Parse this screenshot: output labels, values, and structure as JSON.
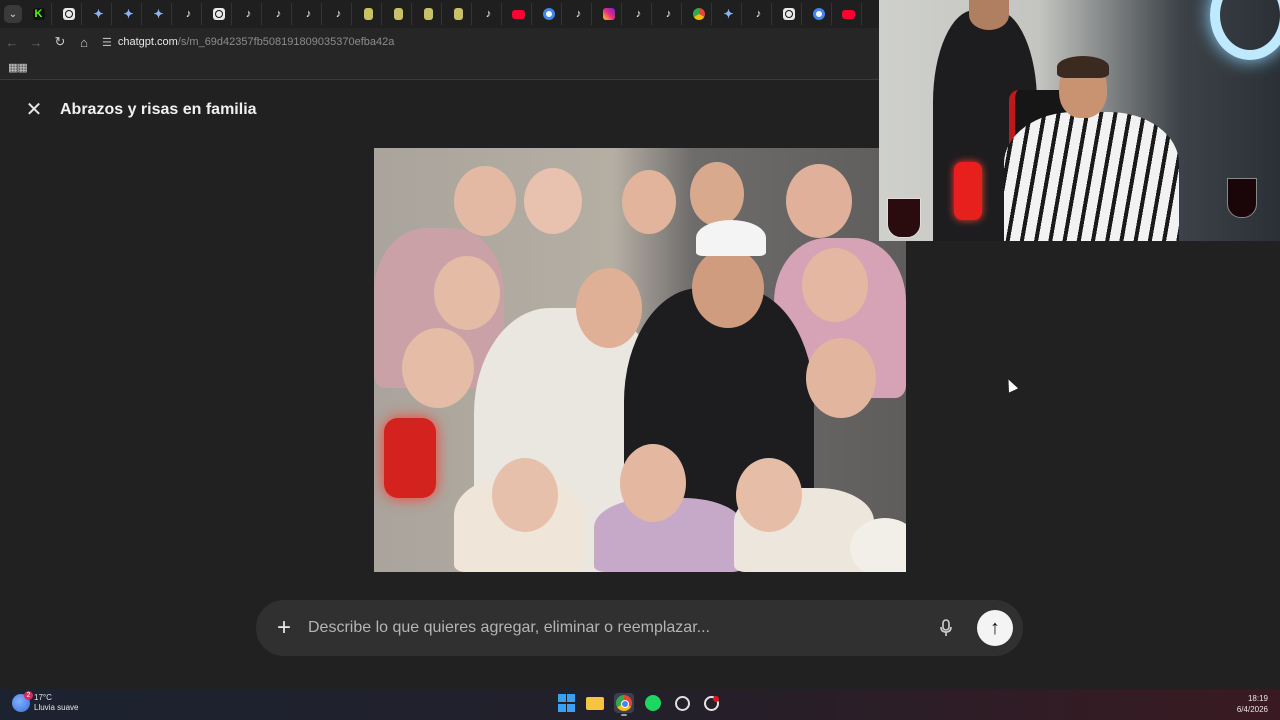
{
  "browser": {
    "tabs": [
      {
        "icon": "kick-icon"
      },
      {
        "icon": "chatgpt-icon"
      },
      {
        "icon": "gemini-icon"
      },
      {
        "icon": "gemini-icon"
      },
      {
        "icon": "gemini-icon"
      },
      {
        "icon": "tiktok-icon"
      },
      {
        "icon": "chatgpt-icon"
      },
      {
        "icon": "tiktok-icon"
      },
      {
        "icon": "tiktok-icon"
      },
      {
        "icon": "tiktok-icon"
      },
      {
        "icon": "tiktok-icon"
      },
      {
        "icon": "doc-icon"
      },
      {
        "icon": "doc-icon"
      },
      {
        "icon": "doc-icon"
      },
      {
        "icon": "doc-icon"
      },
      {
        "icon": "tiktok-icon"
      },
      {
        "icon": "youtube-icon"
      },
      {
        "icon": "google-icon"
      },
      {
        "icon": "tiktok-icon"
      },
      {
        "icon": "instagram-icon"
      },
      {
        "icon": "tiktok-icon"
      },
      {
        "icon": "tiktok-icon"
      },
      {
        "icon": "chrome-icon"
      },
      {
        "icon": "gemini-icon"
      },
      {
        "icon": "tiktok-icon"
      },
      {
        "icon": "chatgpt-icon"
      },
      {
        "icon": "google-icon"
      },
      {
        "icon": "youtube-icon"
      },
      {
        "icon": "chatgpt-icon"
      }
    ],
    "url_host": "chatgpt.com",
    "url_path": "/s/m_69d42357fb508191809035370efba42a"
  },
  "page": {
    "title": "Abrazos y risas en familia",
    "image_alt": "Abrazos y risas en familia",
    "composer_placeholder": "Describe lo que quieres agregar, eliminar o reemplazar..."
  },
  "colors": {
    "page_bg": "#212121",
    "composer_bg": "#303030",
    "send_bg": "#f4f4f4"
  },
  "taskbar": {
    "weather_temp": "17°C",
    "weather_desc": "Lluvia suave",
    "weather_badge": "2",
    "time": "18:19",
    "date": "6/4/2026",
    "apps": [
      "windows-start-icon",
      "file-explorer-icon",
      "chrome-icon",
      "spotify-icon",
      "steam-icon",
      "chatgpt-icon"
    ]
  }
}
